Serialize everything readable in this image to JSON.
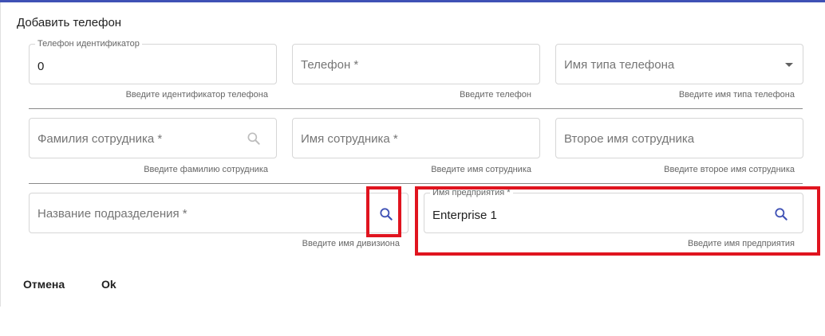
{
  "dialog": {
    "title": "Добавить телефон"
  },
  "fields": {
    "phone_id": {
      "label": "Телефон идентификатор",
      "value": "0",
      "hint": "Введите идентификатор телефона"
    },
    "phone": {
      "placeholder": "Телефон *",
      "hint": "Введите телефон"
    },
    "phone_type": {
      "placeholder": "Имя типа телефона",
      "hint": "Введите имя типа телефона",
      "icon": "chevron-down-icon"
    },
    "last_name": {
      "placeholder": "Фамилия сотрудника *",
      "hint": "Введите фамилию сотрудника",
      "icon": "search-icon"
    },
    "first_name": {
      "placeholder": "Имя сотрудника *",
      "hint": "Введите имя сотрудника"
    },
    "middle_name": {
      "placeholder": "Второе имя сотрудника",
      "hint": "Введите второе имя сотрудника"
    },
    "division": {
      "placeholder": "Название подразделения *",
      "hint": "Введите имя дивизиона",
      "icon": "search-icon"
    },
    "enterprise": {
      "label": "Имя предприятия *",
      "value": "Enterprise 1",
      "hint": "Введите имя предприятия",
      "icon": "search-icon"
    }
  },
  "actions": {
    "cancel_label": "Отмена",
    "ok_label": "Ok"
  },
  "colors": {
    "accent": "#3f51b5",
    "highlight": "#e0141f",
    "icon_active": "#3f51b5",
    "icon_inactive": "#bdbdbd"
  }
}
